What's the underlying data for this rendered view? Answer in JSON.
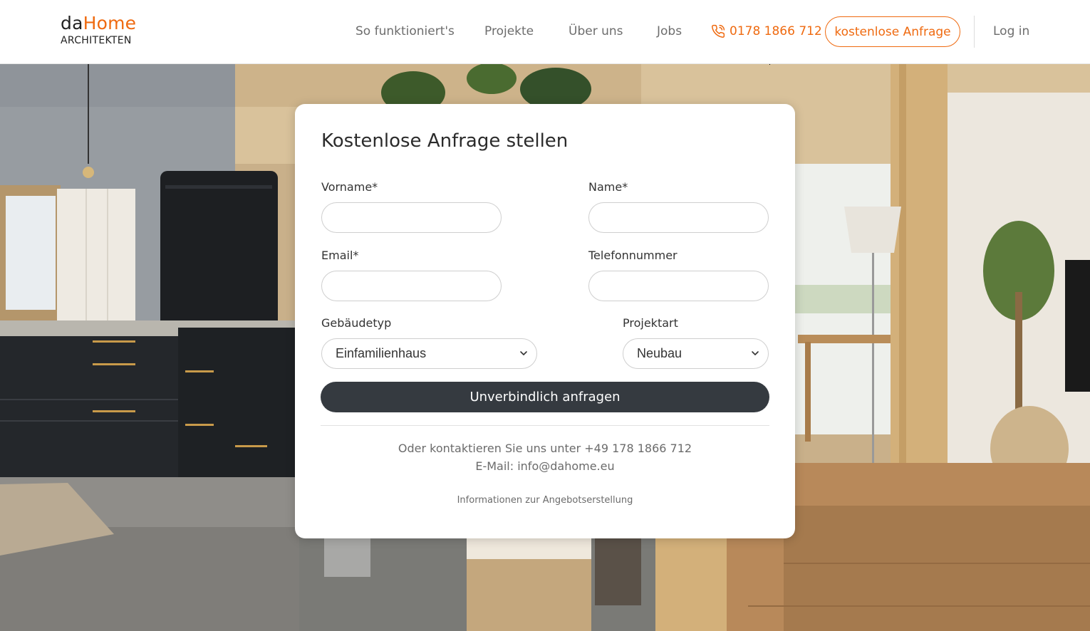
{
  "brand": {
    "name_part1": "da",
    "name_part2": "Home",
    "subtitle": "ARCHITEKTEN",
    "accent_color": "#ef6a10"
  },
  "nav": {
    "items": [
      {
        "label": "So funktioniert's"
      },
      {
        "label": "Projekte"
      },
      {
        "label": "Über uns"
      },
      {
        "label": "Jobs"
      }
    ],
    "phone": {
      "icon": "phone-icon",
      "label": "0178 1866 712"
    },
    "cta_label": "kostenlose Anfrage",
    "login_label": "Log in"
  },
  "form": {
    "title": "Kostenlose Anfrage stellen",
    "fields": {
      "first_name_label": "Vorname*",
      "last_name_label": "Name*",
      "email_label": "Email*",
      "phone_label": "Telefonnummer",
      "building_type_label": "Gebäudetyp",
      "project_type_label": "Projektart"
    },
    "building_type_selected": "Einfamilienhaus",
    "project_type_selected": "Neubau",
    "submit_label": "Unverbindlich anfragen",
    "contact_line": "Oder kontaktieren Sie uns unter +49 178 1866 712",
    "email_line": "E-Mail: info@dahome.eu",
    "info_link": "Informationen zur Angebotserstellung",
    "submit_color": "#353a40"
  }
}
